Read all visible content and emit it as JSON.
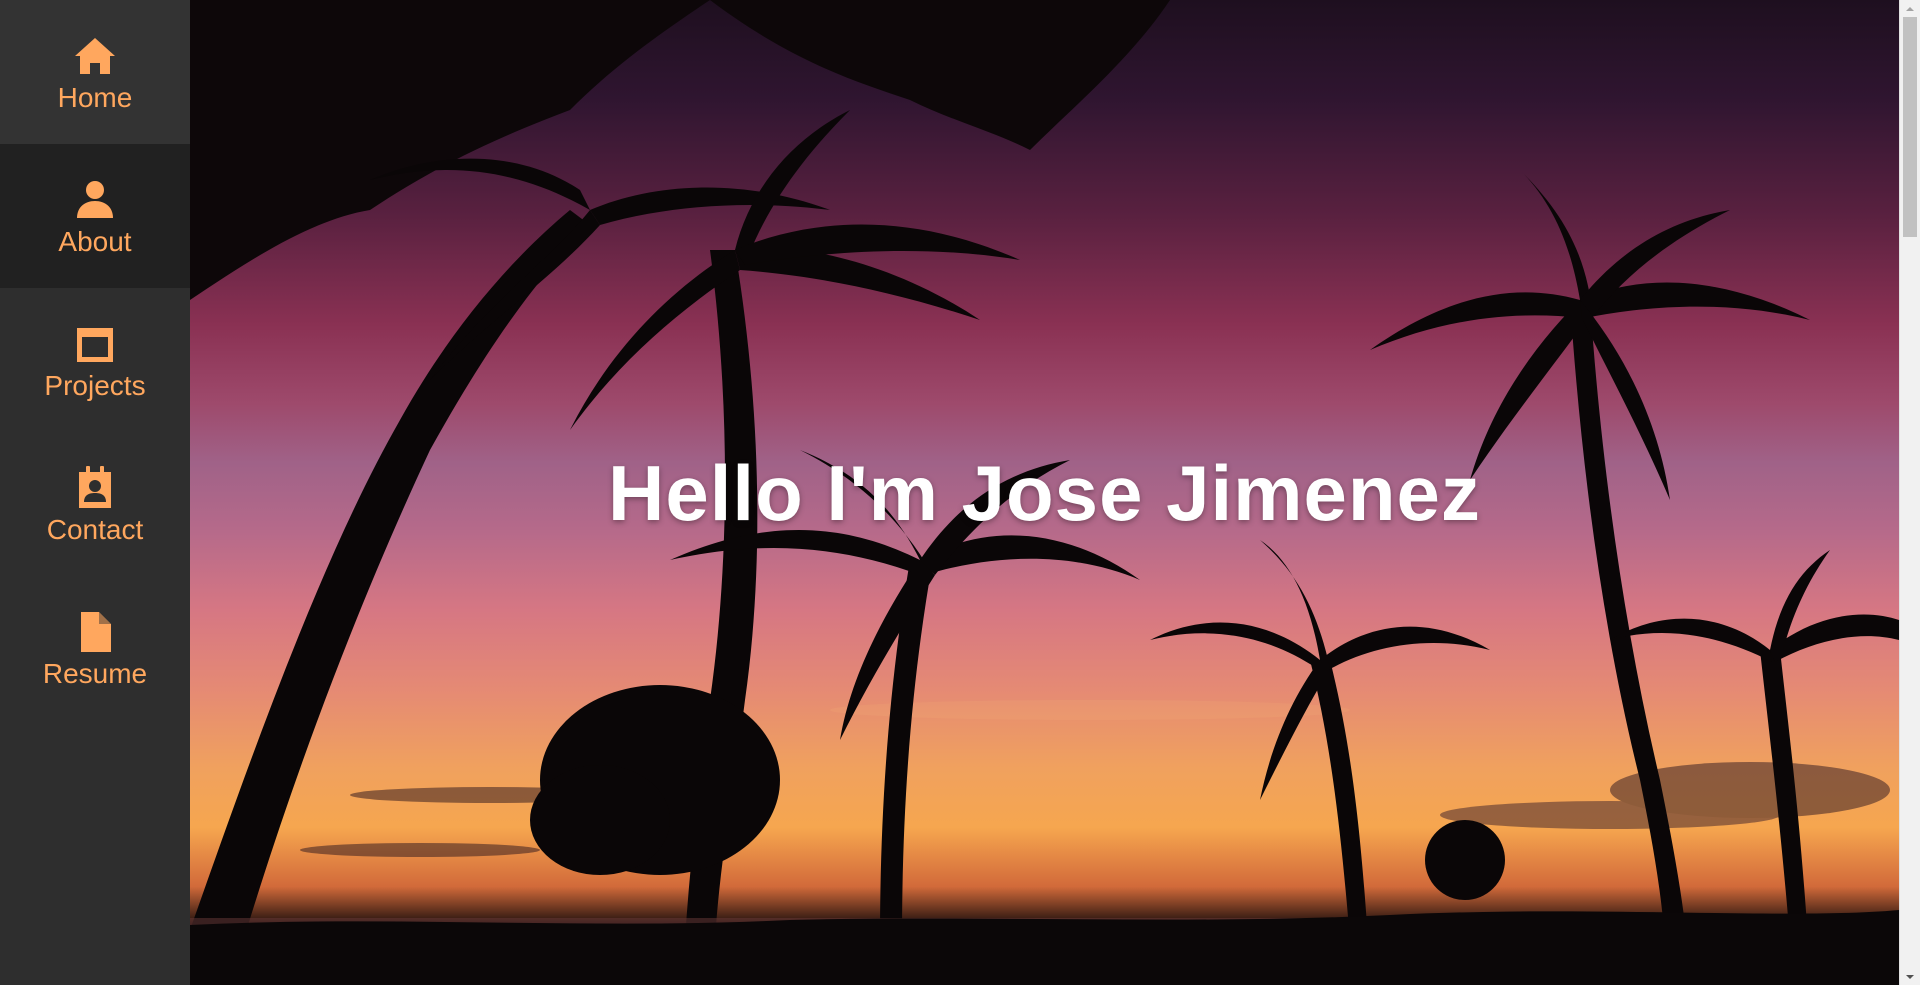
{
  "sidebar": {
    "items": [
      {
        "label": "Home",
        "icon": "home-icon"
      },
      {
        "label": "About",
        "icon": "user-icon"
      },
      {
        "label": "Projects",
        "icon": "window-icon"
      },
      {
        "label": "Contact",
        "icon": "contact-card-icon"
      },
      {
        "label": "Resume",
        "icon": "file-icon"
      }
    ],
    "active": "About",
    "accent_color": "#ffa75e",
    "background": "#2e2e2e"
  },
  "hero": {
    "title": "Hello I'm Jose Jimenez",
    "background": "sunset palm trees photo"
  }
}
